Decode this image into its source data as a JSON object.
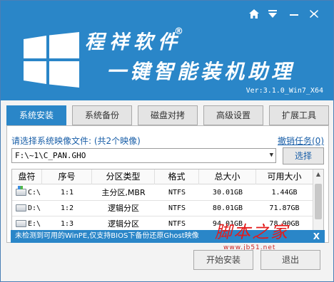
{
  "header": {
    "brand": "程祥软件",
    "registered_mark": "®",
    "tagline": "一键智能装机助理",
    "version": "Ver:3.1.0_Win7_X64",
    "controls": [
      "home-icon",
      "menu-icon",
      "minimize-icon",
      "close-icon"
    ],
    "accent_color": "#2a86c8"
  },
  "tabs": [
    {
      "label": "系统安装",
      "active": true
    },
    {
      "label": "系统备份",
      "active": false
    },
    {
      "label": "磁盘对拷",
      "active": false
    },
    {
      "label": "高级设置",
      "active": false
    },
    {
      "label": "扩展工具",
      "active": false
    }
  ],
  "install": {
    "prompt": "请选择系统映像文件: (共2个映像)",
    "cancel_task": "撤销任务(0)",
    "image_path": "F:\\~1\\C_PAN.GHO",
    "browse_button": "选择"
  },
  "table": {
    "columns": [
      "盘符",
      "序号",
      "分区类型",
      "格式",
      "总大小",
      "可用大小"
    ],
    "rows": [
      {
        "drive": "C:\\",
        "index": "1:1",
        "type": "主分区,MBR",
        "format": "NTFS",
        "total": "30.01GB",
        "free": "1.44GB",
        "system": true
      },
      {
        "drive": "D:\\",
        "index": "1:2",
        "type": "逻辑分区",
        "format": "NTFS",
        "total": "80.01GB",
        "free": "71.87GB",
        "system": false
      },
      {
        "drive": "E:\\",
        "index": "1:3",
        "type": "逻辑分区",
        "format": "NTFS",
        "total": "94.01GB",
        "free": "78.90GB",
        "system": false
      }
    ]
  },
  "status": {
    "message": "未检测到可用的WinPE,仅支持BIOS下备份还原Ghost映像",
    "close": "X"
  },
  "watermark": {
    "text": "脚本之家",
    "url": "www.jb51.net"
  },
  "buttons": {
    "start": "开始安装",
    "exit": "退出"
  }
}
